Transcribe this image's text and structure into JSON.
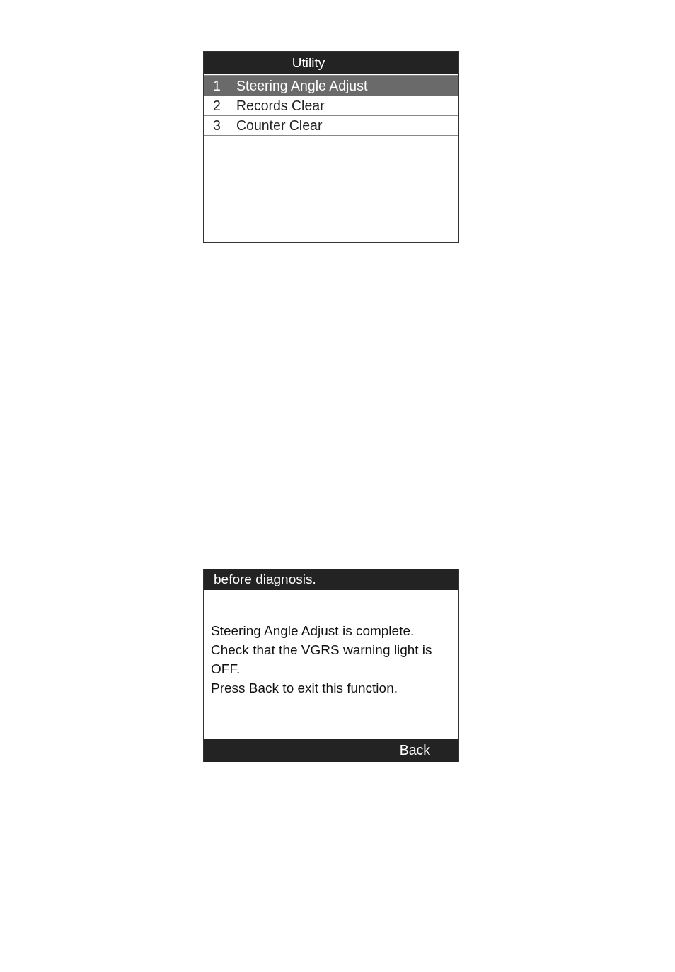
{
  "utility_screen": {
    "title": "Utility",
    "items": [
      {
        "number": "1",
        "label": "Steering Angle Adjust",
        "selected": true
      },
      {
        "number": "2",
        "label": "Records Clear",
        "selected": false
      },
      {
        "number": "3",
        "label": "Counter Clear",
        "selected": false
      }
    ]
  },
  "result_screen": {
    "header": "before diagnosis.",
    "message": [
      "Steering Angle Adjust is complete.",
      "Check that the VGRS warning light is OFF.",
      "Press Back to exit this function."
    ],
    "back_button": "Back"
  }
}
